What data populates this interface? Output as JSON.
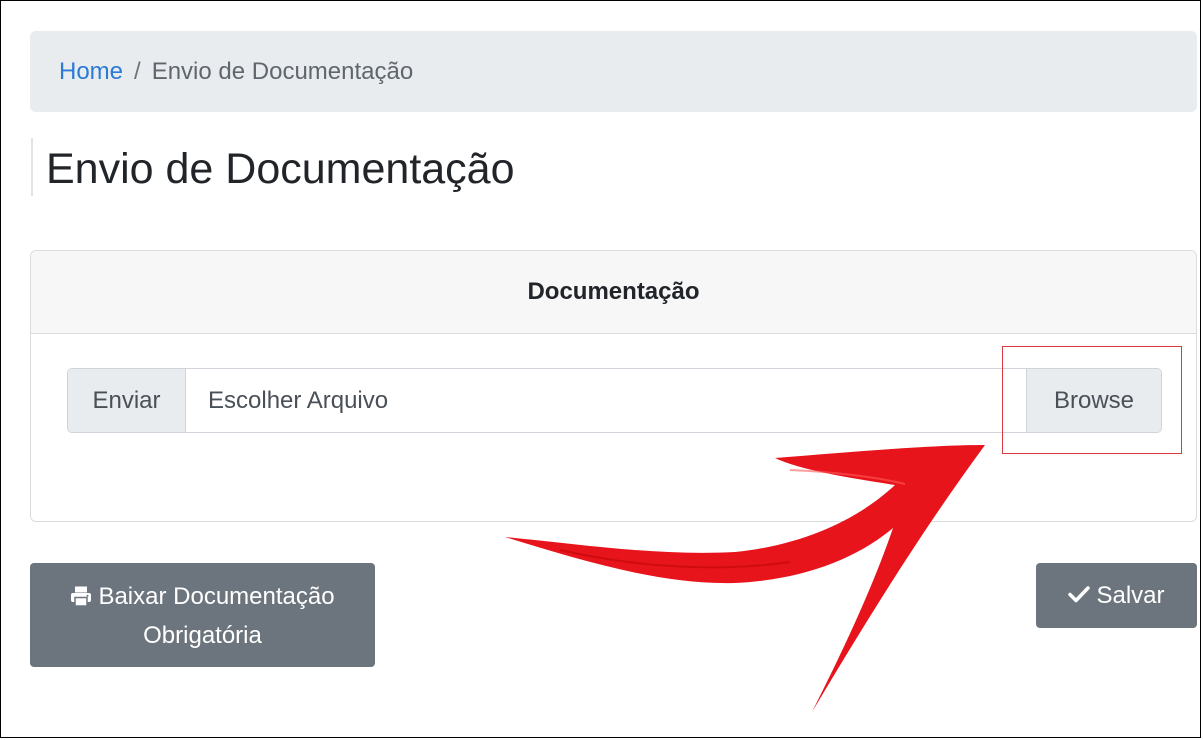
{
  "breadcrumb": {
    "home": "Home",
    "separator": "/",
    "current": "Envio de Documentação"
  },
  "page": {
    "title": "Envio de Documentação"
  },
  "card": {
    "header": "Documentação",
    "file_input": {
      "prefix": "Enviar",
      "placeholder": "Escolher Arquivo",
      "browse_label": "Browse"
    }
  },
  "actions": {
    "download_line1": "Baixar Documentação",
    "download_line2": "Obrigatória",
    "download_icon": "printer-icon",
    "save_label": "Salvar",
    "save_icon": "check-icon"
  },
  "annotation": {
    "arrow_icon": "red-arrow-annotation",
    "highlight_color": "#d9383e",
    "arrow_color": "#e8141c"
  },
  "colors": {
    "link": "#2a7ad6",
    "button_secondary": "#6c757d",
    "breadcrumb_bg": "#e9ecef"
  }
}
